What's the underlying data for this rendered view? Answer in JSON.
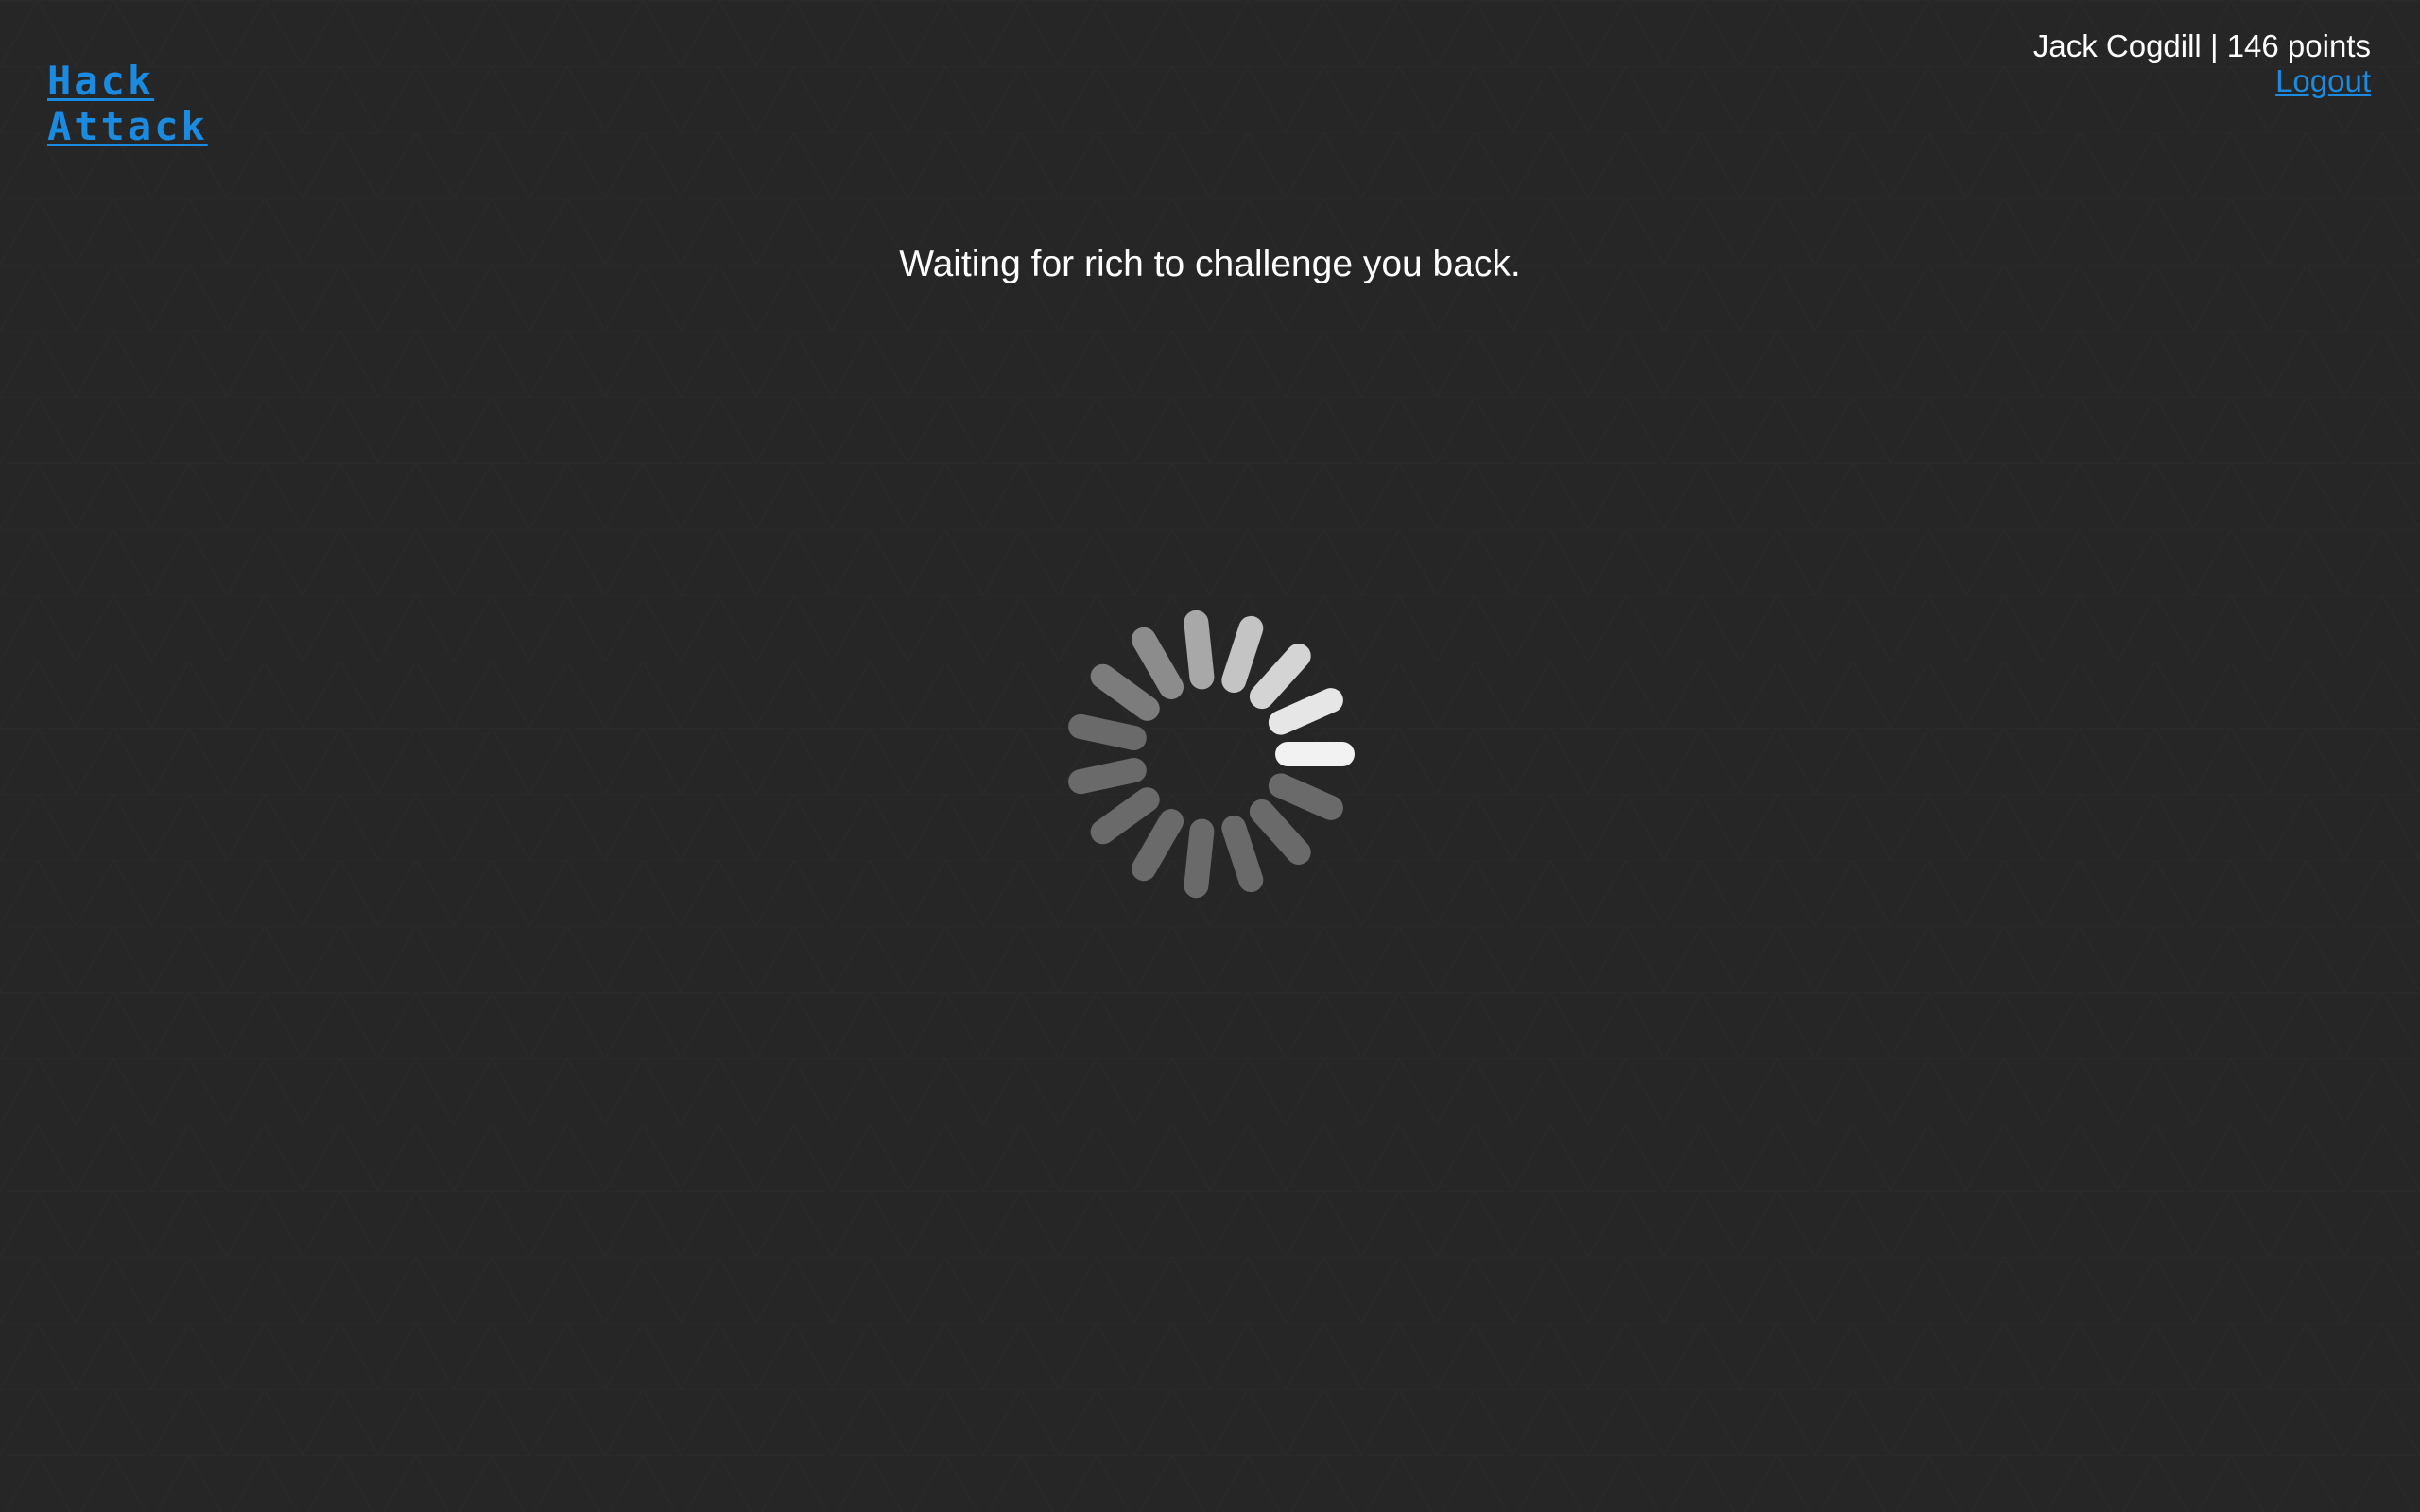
{
  "header": {
    "logo_line1": "Hack",
    "logo_line2": "Attack",
    "user_name": "Jack Cogdill",
    "separator": "|",
    "points": "146 points",
    "logout_label": "Logout"
  },
  "main": {
    "status_message": "Waiting for rich to challenge you back."
  },
  "colors": {
    "background": "#262626",
    "accent": "#1a8be0",
    "text": "#ffffff"
  },
  "icons": {
    "spinner": "loading-spinner-icon"
  }
}
